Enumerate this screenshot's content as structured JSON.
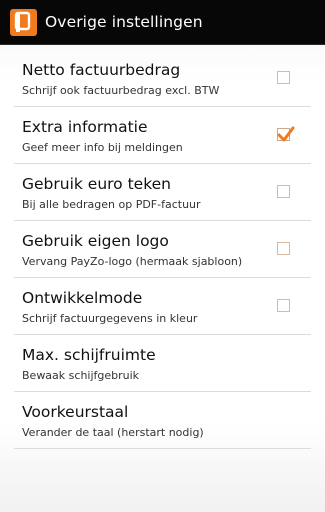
{
  "app": {
    "title": "Overige instellingen",
    "icon": "payzo-app-icon",
    "accent": "#f07a1e"
  },
  "settings": [
    {
      "title": "Netto factuurbedrag",
      "summary": "Schrijf ook factuurbedrag excl. BTW",
      "checkbox": true,
      "checked": false
    },
    {
      "title": "Extra informatie",
      "summary": "Geef meer info bij meldingen",
      "checkbox": true,
      "checked": true
    },
    {
      "title": "Gebruik euro teken",
      "summary": "Bij alle bedragen op PDF-factuur",
      "checkbox": true,
      "checked": false
    },
    {
      "title": "Gebruik eigen logo",
      "summary": "Vervang PayZo-logo (hermaak sjabloon)",
      "checkbox": true,
      "checked": false
    },
    {
      "title": "Ontwikkelmode",
      "summary": "Schrijf factuurgegevens in kleur",
      "checkbox": true,
      "checked": false
    },
    {
      "title": "Max. schijfruimte",
      "summary": "Bewaak schijfgebruik",
      "checkbox": false
    },
    {
      "title": "Voorkeurstaal",
      "summary": "Verander de taal (herstart nodig)",
      "checkbox": false
    }
  ]
}
